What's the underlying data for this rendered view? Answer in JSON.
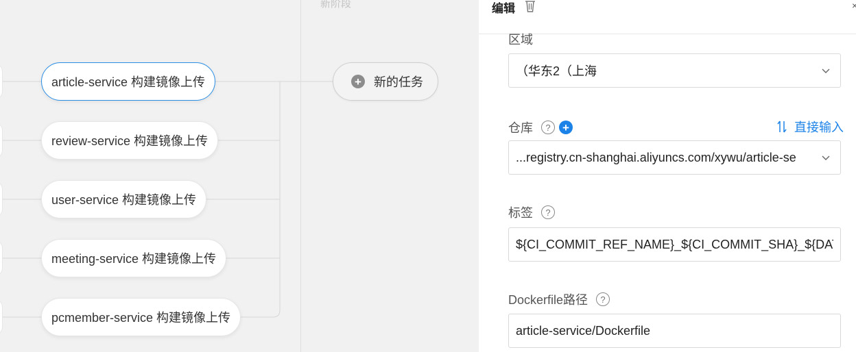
{
  "pipeline": {
    "stage_title": "新阶段",
    "tasks": [
      {
        "label": "article-service 构建镜像上传",
        "active": true
      },
      {
        "label": "review-service 构建镜像上传",
        "active": false
      },
      {
        "label": "user-service 构建镜像上传",
        "active": false
      },
      {
        "label": "meeting-service 构建镜像上传",
        "active": false
      },
      {
        "label": "pcmember-service 构建镜像上传",
        "active": false
      }
    ],
    "new_task_label": "新的任务"
  },
  "panel": {
    "title": "编辑",
    "region": {
      "label": "区域",
      "value": "（华东2（上海"
    },
    "repository": {
      "label": "仓库",
      "value": "...registry.cn-shanghai.aliyuncs.com/xywu/article-se",
      "direct_input_label": "直接输入"
    },
    "tag": {
      "label": "标签",
      "value": "${CI_COMMIT_REF_NAME}_${CI_COMMIT_SHA}_${DATETIME}"
    },
    "dockerfile": {
      "label": "Dockerfile路径",
      "value": "article-service/Dockerfile"
    }
  },
  "colors": {
    "accent": "#1b82e8",
    "active_border": "#2a8ee5"
  }
}
